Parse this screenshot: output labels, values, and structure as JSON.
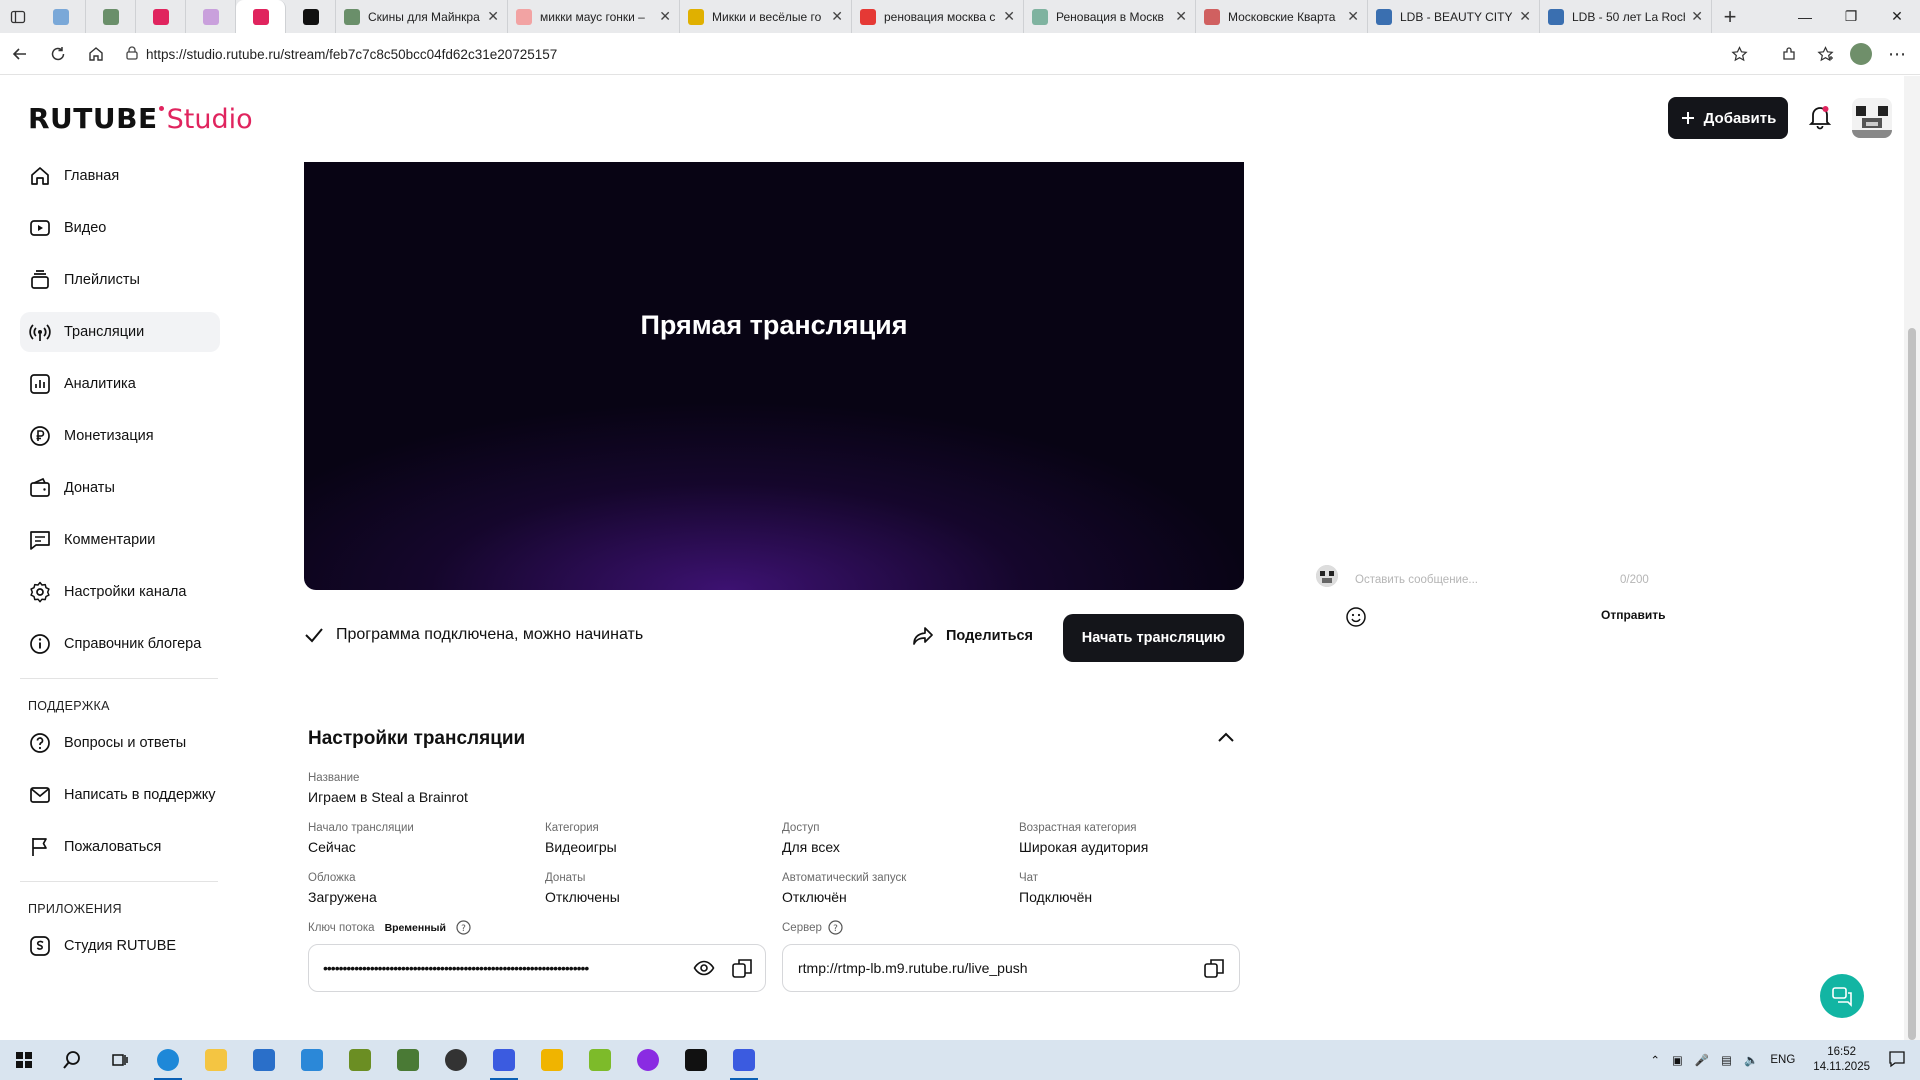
{
  "browser": {
    "tabs": [
      {
        "label": "",
        "color": "#7aa8d8",
        "pinned": true
      },
      {
        "label": "",
        "color": "#6a8f6a",
        "pinned": true
      },
      {
        "label": "",
        "color": "#e0245e",
        "pinned": true
      },
      {
        "label": "",
        "color": "#c9a0dc",
        "pinned": true
      },
      {
        "label": "",
        "color": "#e0245e",
        "pinned": true,
        "active": true
      },
      {
        "label": "",
        "color": "#111",
        "pinned": true
      },
      {
        "label": "Скины для Майнкра",
        "color": "#6a8f6a"
      },
      {
        "label": "микки маус гонки –",
        "color": "#f2a3a3"
      },
      {
        "label": "Микки и весёлые го",
        "color": "#e0b000"
      },
      {
        "label": "реновация москва с",
        "color": "#e53935"
      },
      {
        "label": "Реновация в Москв",
        "color": "#7fb3a0"
      },
      {
        "label": "Московские Кварта",
        "color": "#d06060"
      },
      {
        "label": "LDB - BEAUTY CITY",
        "color": "#3a6fb0"
      },
      {
        "label": "LDB - 50 лет La Roch",
        "color": "#3a6fb0"
      }
    ],
    "url": "https://studio.rutube.ru/stream/feb7c7c8c50bcc04fd62c31e20725157"
  },
  "header": {
    "logo_main": "RUTUBE",
    "logo_sub": "Studio",
    "add_label": "Добавить"
  },
  "sidebar": {
    "items": [
      {
        "label": "Главная",
        "icon": "home-icon"
      },
      {
        "label": "Видео",
        "icon": "video-icon"
      },
      {
        "label": "Плейлисты",
        "icon": "playlist-icon"
      },
      {
        "label": "Трансляции",
        "icon": "broadcast-icon",
        "active": true
      },
      {
        "label": "Аналитика",
        "icon": "analytics-icon"
      },
      {
        "label": "Монетизация",
        "icon": "ruble-icon"
      },
      {
        "label": "Донаты",
        "icon": "wallet-icon"
      },
      {
        "label": "Комментарии",
        "icon": "comment-icon"
      },
      {
        "label": "Настройки канала",
        "icon": "gear-icon"
      },
      {
        "label": "Справочник блогера",
        "icon": "info-icon"
      }
    ],
    "support_heading": "ПОДДЕРЖКА",
    "support_items": [
      {
        "label": "Вопросы и ответы",
        "icon": "question-icon"
      },
      {
        "label": "Написать в поддержку",
        "icon": "mail-icon"
      },
      {
        "label": "Пожаловаться",
        "icon": "flag-icon"
      }
    ],
    "apps_heading": "ПРИЛОЖЕНИЯ",
    "apps_items": [
      {
        "label": "Студия RUTUBE",
        "icon": "studio-app-icon"
      }
    ]
  },
  "player": {
    "title": "Прямая трансляция"
  },
  "stream": {
    "status": "Программа подключена, можно начинать",
    "share_label": "Поделиться",
    "start_label": "Начать трансляцию"
  },
  "settings": {
    "title": "Настройки трансляции",
    "name_label": "Название",
    "name_value": "Играем в Steal a Brainrot",
    "fields": [
      {
        "label": "Начало трансляции",
        "value": "Сейчас"
      },
      {
        "label": "Категория",
        "value": "Видеоигры"
      },
      {
        "label": "Доступ",
        "value": "Для всех"
      },
      {
        "label": "Возрастная категория",
        "value": "Широкая аудитория"
      },
      {
        "label": "Обложка",
        "value": "Загружена"
      },
      {
        "label": "Донаты",
        "value": "Отключены"
      },
      {
        "label": "Автоматический запуск",
        "value": "Отключён"
      },
      {
        "label": "Чат",
        "value": "Подключён"
      }
    ],
    "key_label": "Ключ потока",
    "key_badge": "Временный",
    "key_value": "••••••••••••••••••••••••••••••••••••••••••••••••••••••••••••••••••••",
    "server_label": "Сервер",
    "server_value": "rtmp://rtmp-lb.m9.rutube.ru/live_push"
  },
  "chat": {
    "placeholder": "Оставить сообщение...",
    "counter": "0/200",
    "send_label": "Отправить"
  },
  "taskbar": {
    "lang": "ENG",
    "time": "16:52",
    "date": "14.11.2025"
  }
}
